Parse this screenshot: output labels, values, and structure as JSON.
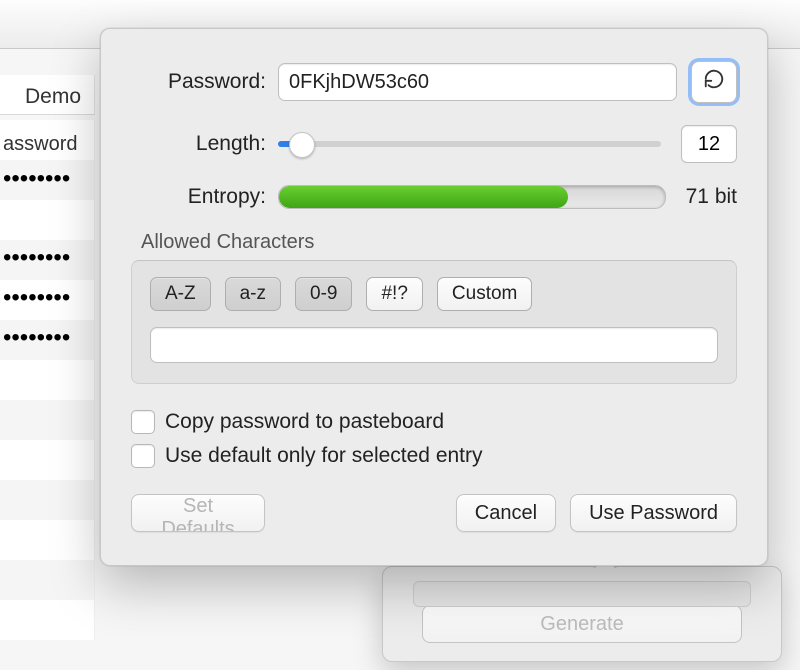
{
  "labels": {
    "password": "Password:",
    "length": "Length:",
    "entropy": "Entropy:",
    "allowed": "Allowed Characters",
    "copy": "Copy password to pasteboard",
    "use_default": "Use default only for selected entry"
  },
  "values": {
    "password": "0FKjhDW53c60",
    "length": "12",
    "entropy": "71 bit",
    "custom_chars": ""
  },
  "toggles": {
    "upper": "A-Z",
    "lower": "a-z",
    "digits": "0-9",
    "symbols": "#!?",
    "custom": "Custom"
  },
  "buttons": {
    "set_defaults": "Set Defaults",
    "cancel": "Cancel",
    "use_password": "Use Password",
    "generate": "Generate"
  },
  "background": {
    "tab": "Demo",
    "column": "assword"
  }
}
